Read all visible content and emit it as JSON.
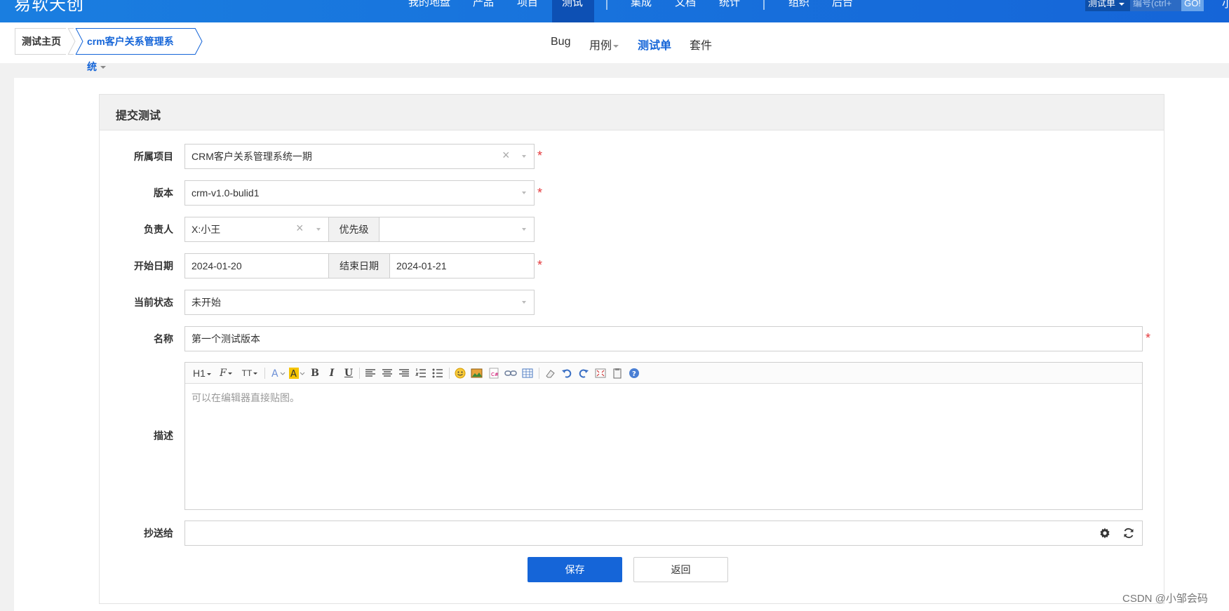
{
  "topnav": {
    "brand": "易软天创",
    "items": [
      "我的地盘",
      "产品",
      "项目",
      "测试",
      "集成",
      "文档",
      "统计",
      "组织",
      "后台"
    ],
    "active_item": "测试",
    "search_type": "测试单",
    "search_placeholder": "编号(ctrl+",
    "go_label": "GO!",
    "user_initial": "小"
  },
  "subnav": {
    "home_crumb": "测试主页",
    "product_crumb": "crm客户关系管理系统",
    "tabs": [
      "Bug",
      "用例",
      "测试单",
      "套件"
    ],
    "active_tab": "测试单"
  },
  "form": {
    "title": "提交测试",
    "project_label": "所属项目",
    "project_value": "CRM客户关系管理系统一期",
    "version_label": "版本",
    "version_value": "crm-v1.0-bulid1",
    "owner_label": "负责人",
    "owner_value": "X:小王",
    "priority_label": "优先级",
    "priority_value": "",
    "start_label": "开始日期",
    "start_value": "2024-01-20",
    "end_label": "结束日期",
    "end_value": "2024-01-21",
    "status_label": "当前状态",
    "status_value": "未开始",
    "name_label": "名称",
    "name_value": "第一个测试版本",
    "desc_label": "描述",
    "desc_placeholder": "可以在编辑器直接贴图。",
    "cc_label": "抄送给",
    "cc_value": "",
    "save_label": "保存",
    "back_label": "返回",
    "required_mark": "*",
    "clear_mark": "×"
  },
  "toolbar": {
    "heading": "H1",
    "font_family": "F",
    "font_size": "TT",
    "bold": "B",
    "italic": "I",
    "underline": "U"
  },
  "watermark": "CSDN @小邹会码"
}
